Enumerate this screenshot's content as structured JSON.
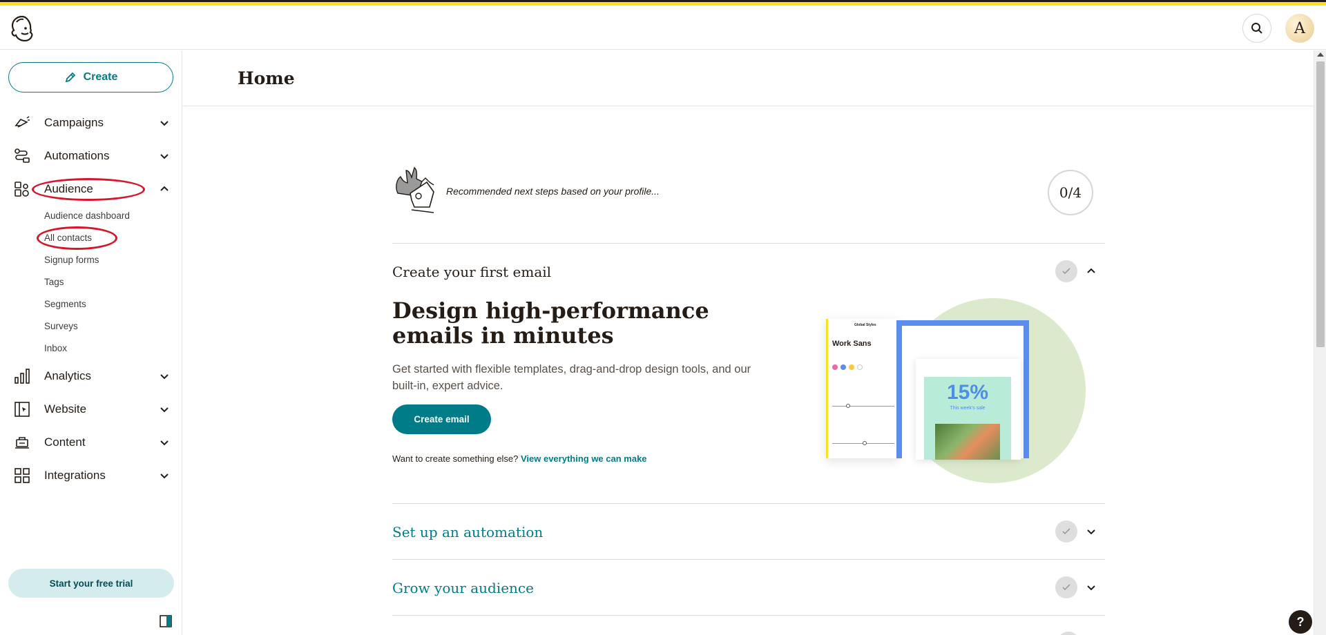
{
  "header": {
    "avatar_initial": "A"
  },
  "sidebar": {
    "create_label": "Create",
    "nav": [
      {
        "label": "Campaigns"
      },
      {
        "label": "Automations"
      },
      {
        "label": "Audience"
      },
      {
        "label": "Analytics"
      },
      {
        "label": "Website"
      },
      {
        "label": "Content"
      },
      {
        "label": "Integrations"
      }
    ],
    "audience_sub": [
      "Audience dashboard",
      "All contacts",
      "Signup forms",
      "Tags",
      "Segments",
      "Surveys",
      "Inbox"
    ],
    "trial_label": "Start your free trial"
  },
  "main": {
    "page_title": "Home",
    "recommend_text": "Recommended next steps based on your profile...",
    "progress_text": "0/4",
    "sections": [
      {
        "title": "Create your first email",
        "expanded": true
      },
      {
        "title": "Set up an automation",
        "expanded": false
      },
      {
        "title": "Grow your audience",
        "expanded": false
      }
    ],
    "card": {
      "headline": "Design high-performance emails in minutes",
      "copy": "Get started with flexible templates, drag-and-drop design tools, and our built-in, expert advice.",
      "button_label": "Create email",
      "more_prefix": "Want to create something else?",
      "more_link": "View everything we can make"
    },
    "illustration": {
      "panel_title": "Global Styles",
      "font_name": "Work Sans",
      "discount": "15%",
      "discount_sub": "This week's sale"
    }
  },
  "help_label": "?",
  "colors": {
    "accent": "#007c89",
    "brand_yellow": "#ffe01b",
    "annotation_red": "#d9142b"
  }
}
